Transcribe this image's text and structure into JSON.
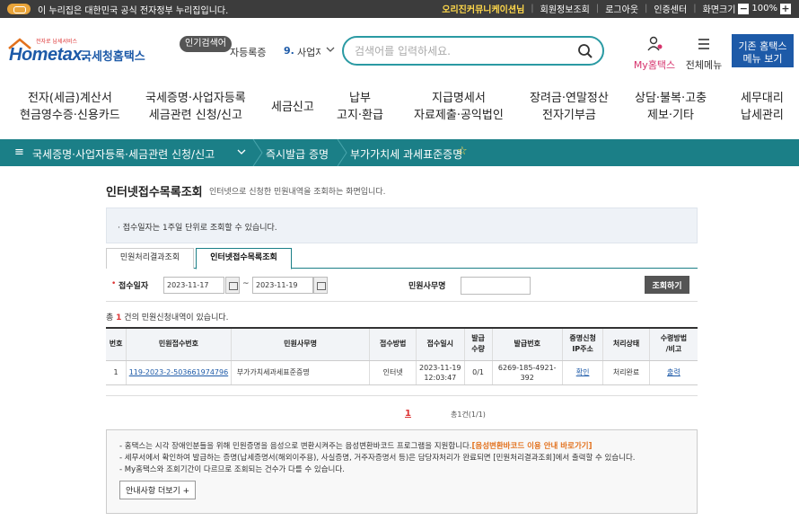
{
  "gov_bar": {
    "text": "이 누리집은 대한민국 공식 전자정부 누리집입니다.",
    "user": "오리진커뮤니케이션님",
    "links": [
      "회원정보조회",
      "로그아웃",
      "인증센터",
      "화면크기"
    ],
    "zoom_minus": "−",
    "zoom_level": "100%",
    "zoom_plus": "+"
  },
  "header": {
    "logo_sub": "전자로 납세서비스",
    "logo_text": "Hometax.",
    "logo_kor": "국세청홈택스",
    "popular_badge": "인기검색어",
    "popular_prev": "자등록증",
    "popular_num": "9.",
    "popular_item": "사업자",
    "search_placeholder": "검색어를 입력하세요.",
    "my_home_label": "My홈택스",
    "all_menu_label": "전체메뉴",
    "classic_line1": "기존 홈택스",
    "classic_line2": "메뉴 보기"
  },
  "nav": [
    {
      "line1": "전자(세금)계산서",
      "line2": "현금영수증·신용카드"
    },
    {
      "line1": "국세증명·사업자등록",
      "line2": "세금관련 신청/신고"
    },
    {
      "line1": "세금신고",
      "line2": ""
    },
    {
      "line1": "납부",
      "line2": "고지·환급"
    },
    {
      "line1": "지급명세서",
      "line2": "자료제출·공익법인"
    },
    {
      "line1": "장려금·연말정산",
      "line2": "전자기부금"
    },
    {
      "line1": "상담·불복·고충",
      "line2": "제보·기타"
    },
    {
      "line1": "세무대리",
      "line2": "납세관리"
    }
  ],
  "breadcrumb": {
    "menu_icon": "≡",
    "items": [
      "국세증명·사업자등록·세금관련 신청/신고",
      "즉시발급 증명",
      "부가가치세 과세표준증명"
    ]
  },
  "page": {
    "title": "인터넷접수목록조회",
    "desc": "인터넷으로 신청한 민원내역을 조회하는 화면입니다.",
    "notice": "· 접수일자는 1주일 단위로 조회할 수 있습니다.",
    "tabs": [
      "민원처리결과조회",
      "인터넷접수목록조회"
    ],
    "filter": {
      "required_mark": "•",
      "date_label": "접수일자",
      "date_from": "2023-11-17",
      "date_to": "2023-11-19",
      "tilde": "~",
      "office_label": "민원사무명",
      "office_value": "",
      "search_button": "조회하기"
    },
    "result": {
      "prefix": "총 ",
      "count": "1",
      "suffix": " 건의 민원신청내역이 있습니다."
    },
    "table": {
      "headers": [
        "번호",
        "민원접수번호",
        "민원사무명",
        "접수방법",
        "접수일시",
        "발급\n수량",
        "발급번호",
        "증명신청\nIP주소",
        "처리상태",
        "수령방법\n/비고"
      ],
      "rows": [
        {
          "no": "1",
          "receipt_no": "119-2023-2-503661974796",
          "office": "부가가치세과세표준증명",
          "method": "인터넷",
          "date": "2023-11-19",
          "time": "12:03:47",
          "qty": "0/1",
          "issue_no": "6269-185-4921-392",
          "ip": "확인",
          "status": "처리완료",
          "receive": "출력"
        }
      ]
    },
    "pager": {
      "current": "1",
      "total": "총1건(1/1)"
    },
    "info": {
      "line1": "- 홈택스는 시각 장애인분들을 위해 민원증명을 음성으로 변환시켜주는 음성변환바코드 프로그램을 지원합니다.",
      "line1_link": "[음성변환바코드 이용 안내 바로가기]",
      "line2": "- 세무서에서 확인하여 발급하는 증명(납세증명서(해외이주용), 사실증명, 거주자증명서 등)은 담당자처리가 완료되면 [민원처리결과조회]에서 출력할 수 있습니다.",
      "line3": "- My홈택스와 조회기간이 다르므로 조회되는 건수가 다를 수 있습니다.",
      "more_button": "안내사항 더보기 +"
    }
  },
  "colors": {
    "teal": "#1b7f87",
    "brand_blue": "#1d5aa8",
    "accent_red": "#d33",
    "accent_orange": "#e2711d"
  }
}
